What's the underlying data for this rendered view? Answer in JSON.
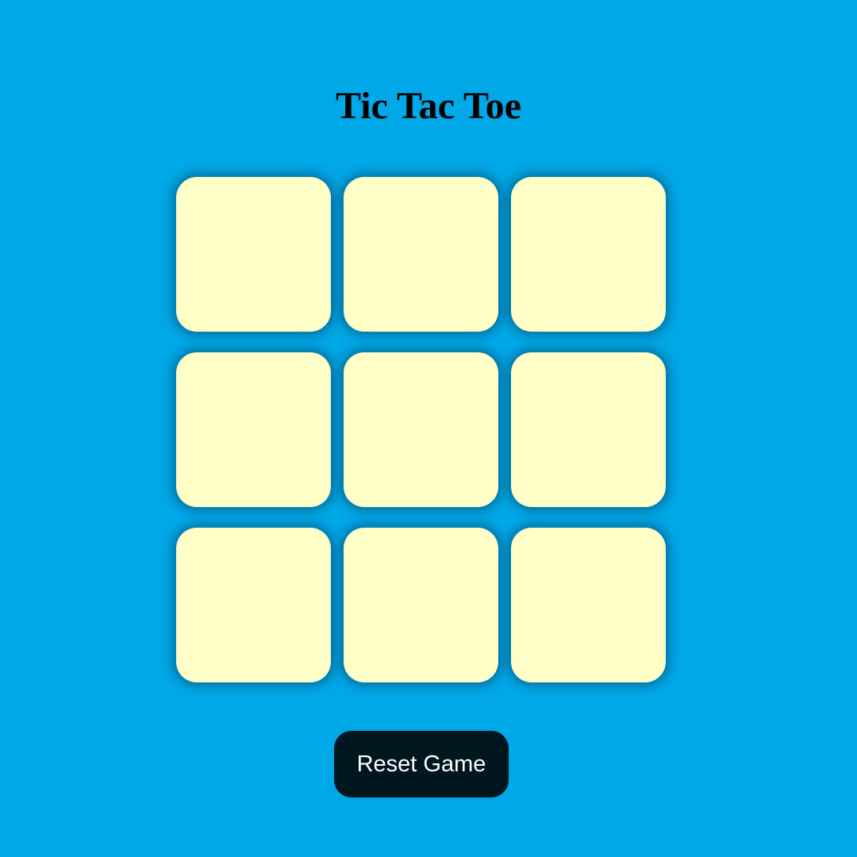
{
  "game": {
    "title": "Tic Tac Toe",
    "board": {
      "cells": [
        "",
        "",
        "",
        "",
        "",
        "",
        "",
        "",
        ""
      ]
    },
    "reset_label": "Reset Game"
  },
  "colors": {
    "background": "#00a8e8",
    "cell": "#ffffc7",
    "button": "#00171f",
    "button_text": "#ffffff",
    "title": "#000000"
  }
}
